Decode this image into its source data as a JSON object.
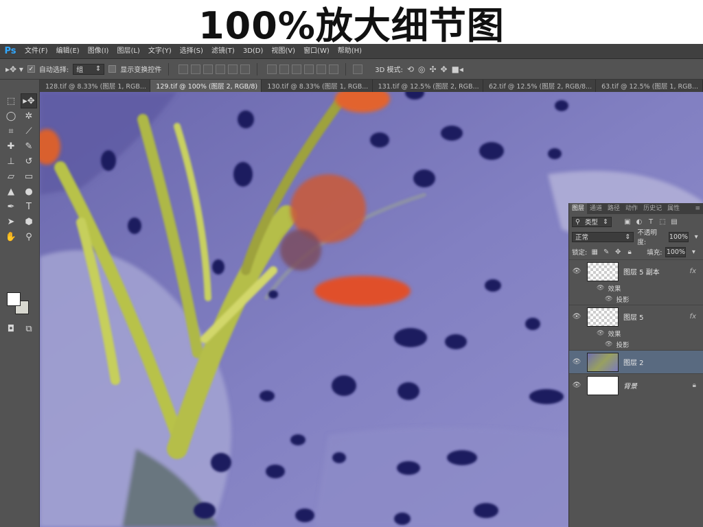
{
  "banner": {
    "title": "100%放大细节图"
  },
  "app": {
    "logo": "Ps"
  },
  "menu": [
    "文件(F)",
    "编辑(E)",
    "图像(I)",
    "图层(L)",
    "文字(Y)",
    "选择(S)",
    "滤镜(T)",
    "3D(D)",
    "视图(V)",
    "窗口(W)",
    "帮助(H)"
  ],
  "options": {
    "auto_select_label": "自动选择:",
    "auto_select_value": "组",
    "show_transform_label": "显示变换控件",
    "mode3d_label": "3D 模式:"
  },
  "tabs": [
    {
      "label": "128.tif @ 8.33% (图层 1, RGB...",
      "active": false
    },
    {
      "label": "129.tif @ 100% (图层 2, RGB/8)",
      "active": true
    },
    {
      "label": "130.tif @ 8.33% (图层 1, RGB...",
      "active": false
    },
    {
      "label": "131.tif @ 12.5% (图层 2, RGB...",
      "active": false
    },
    {
      "label": "62.tif @ 12.5% (图层 2, RGB/8...",
      "active": false
    },
    {
      "label": "63.tif @ 12.5% (图层 1, RGB...",
      "active": false
    }
  ],
  "layers_panel": {
    "tabs": [
      "图层",
      "通道",
      "路径",
      "动作",
      "历史记",
      "属性"
    ],
    "filter_label": "类型",
    "blend_mode": "正常",
    "opacity_label": "不透明度:",
    "opacity_value": "100%",
    "lock_label": "锁定:",
    "fill_label": "填充:",
    "fill_value": "100%",
    "effects_label": "效果",
    "shadow_label": "投影",
    "layers": [
      {
        "name": "图层 5 副本",
        "fx": "fx"
      },
      {
        "name": "图层 5",
        "fx": "fx"
      },
      {
        "name": "图层 2"
      },
      {
        "name": "背景"
      }
    ]
  },
  "colors": {
    "canvas_bg": "#7a77b8",
    "selected_layer": "#596a80",
    "ps_blue": "#31a8ff"
  }
}
